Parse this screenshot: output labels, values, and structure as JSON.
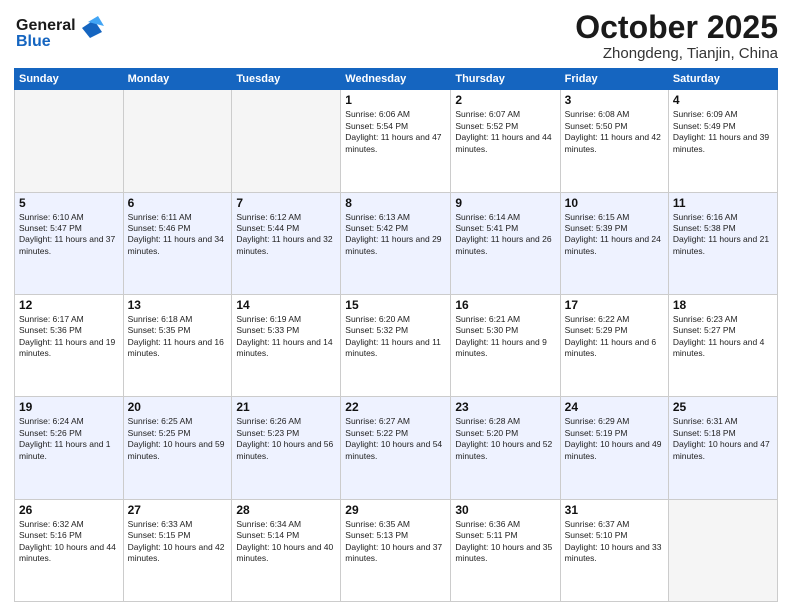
{
  "header": {
    "logo_line1": "General",
    "logo_line2": "Blue",
    "month": "October 2025",
    "location": "Zhongdeng, Tianjin, China"
  },
  "weekdays": [
    "Sunday",
    "Monday",
    "Tuesday",
    "Wednesday",
    "Thursday",
    "Friday",
    "Saturday"
  ],
  "weeks": [
    [
      {
        "day": "",
        "text": ""
      },
      {
        "day": "",
        "text": ""
      },
      {
        "day": "",
        "text": ""
      },
      {
        "day": "1",
        "text": "Sunrise: 6:06 AM\nSunset: 5:54 PM\nDaylight: 11 hours and 47 minutes."
      },
      {
        "day": "2",
        "text": "Sunrise: 6:07 AM\nSunset: 5:52 PM\nDaylight: 11 hours and 44 minutes."
      },
      {
        "day": "3",
        "text": "Sunrise: 6:08 AM\nSunset: 5:50 PM\nDaylight: 11 hours and 42 minutes."
      },
      {
        "day": "4",
        "text": "Sunrise: 6:09 AM\nSunset: 5:49 PM\nDaylight: 11 hours and 39 minutes."
      }
    ],
    [
      {
        "day": "5",
        "text": "Sunrise: 6:10 AM\nSunset: 5:47 PM\nDaylight: 11 hours and 37 minutes."
      },
      {
        "day": "6",
        "text": "Sunrise: 6:11 AM\nSunset: 5:46 PM\nDaylight: 11 hours and 34 minutes."
      },
      {
        "day": "7",
        "text": "Sunrise: 6:12 AM\nSunset: 5:44 PM\nDaylight: 11 hours and 32 minutes."
      },
      {
        "day": "8",
        "text": "Sunrise: 6:13 AM\nSunset: 5:42 PM\nDaylight: 11 hours and 29 minutes."
      },
      {
        "day": "9",
        "text": "Sunrise: 6:14 AM\nSunset: 5:41 PM\nDaylight: 11 hours and 26 minutes."
      },
      {
        "day": "10",
        "text": "Sunrise: 6:15 AM\nSunset: 5:39 PM\nDaylight: 11 hours and 24 minutes."
      },
      {
        "day": "11",
        "text": "Sunrise: 6:16 AM\nSunset: 5:38 PM\nDaylight: 11 hours and 21 minutes."
      }
    ],
    [
      {
        "day": "12",
        "text": "Sunrise: 6:17 AM\nSunset: 5:36 PM\nDaylight: 11 hours and 19 minutes."
      },
      {
        "day": "13",
        "text": "Sunrise: 6:18 AM\nSunset: 5:35 PM\nDaylight: 11 hours and 16 minutes."
      },
      {
        "day": "14",
        "text": "Sunrise: 6:19 AM\nSunset: 5:33 PM\nDaylight: 11 hours and 14 minutes."
      },
      {
        "day": "15",
        "text": "Sunrise: 6:20 AM\nSunset: 5:32 PM\nDaylight: 11 hours and 11 minutes."
      },
      {
        "day": "16",
        "text": "Sunrise: 6:21 AM\nSunset: 5:30 PM\nDaylight: 11 hours and 9 minutes."
      },
      {
        "day": "17",
        "text": "Sunrise: 6:22 AM\nSunset: 5:29 PM\nDaylight: 11 hours and 6 minutes."
      },
      {
        "day": "18",
        "text": "Sunrise: 6:23 AM\nSunset: 5:27 PM\nDaylight: 11 hours and 4 minutes."
      }
    ],
    [
      {
        "day": "19",
        "text": "Sunrise: 6:24 AM\nSunset: 5:26 PM\nDaylight: 11 hours and 1 minute."
      },
      {
        "day": "20",
        "text": "Sunrise: 6:25 AM\nSunset: 5:25 PM\nDaylight: 10 hours and 59 minutes."
      },
      {
        "day": "21",
        "text": "Sunrise: 6:26 AM\nSunset: 5:23 PM\nDaylight: 10 hours and 56 minutes."
      },
      {
        "day": "22",
        "text": "Sunrise: 6:27 AM\nSunset: 5:22 PM\nDaylight: 10 hours and 54 minutes."
      },
      {
        "day": "23",
        "text": "Sunrise: 6:28 AM\nSunset: 5:20 PM\nDaylight: 10 hours and 52 minutes."
      },
      {
        "day": "24",
        "text": "Sunrise: 6:29 AM\nSunset: 5:19 PM\nDaylight: 10 hours and 49 minutes."
      },
      {
        "day": "25",
        "text": "Sunrise: 6:31 AM\nSunset: 5:18 PM\nDaylight: 10 hours and 47 minutes."
      }
    ],
    [
      {
        "day": "26",
        "text": "Sunrise: 6:32 AM\nSunset: 5:16 PM\nDaylight: 10 hours and 44 minutes."
      },
      {
        "day": "27",
        "text": "Sunrise: 6:33 AM\nSunset: 5:15 PM\nDaylight: 10 hours and 42 minutes."
      },
      {
        "day": "28",
        "text": "Sunrise: 6:34 AM\nSunset: 5:14 PM\nDaylight: 10 hours and 40 minutes."
      },
      {
        "day": "29",
        "text": "Sunrise: 6:35 AM\nSunset: 5:13 PM\nDaylight: 10 hours and 37 minutes."
      },
      {
        "day": "30",
        "text": "Sunrise: 6:36 AM\nSunset: 5:11 PM\nDaylight: 10 hours and 35 minutes."
      },
      {
        "day": "31",
        "text": "Sunrise: 6:37 AM\nSunset: 5:10 PM\nDaylight: 10 hours and 33 minutes."
      },
      {
        "day": "",
        "text": ""
      }
    ]
  ]
}
